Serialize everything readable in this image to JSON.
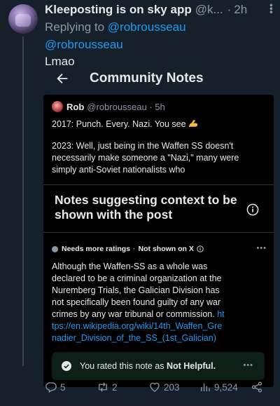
{
  "tweet": {
    "display_name": "Kleeposting is on sky app",
    "handle": "@k...",
    "separator": "·",
    "time": "2h",
    "replying_prefix": "Replying to",
    "replying_to": "@robrousseau",
    "mention": "@robrousseau",
    "text": "Lmao"
  },
  "community_notes": {
    "title": "Community Notes",
    "quoted_post": {
      "name": "Rob",
      "handle_time": "@robrousseau · 5h",
      "line1": "2017: Punch. Every. Nazi. You see",
      "line2": "2023: Well, just being in the Waffen SS doesn't necessarily make someone a \"Nazi,\" many were simply anti-Soviet nationalists who"
    },
    "heading": "Notes suggesting context to be shown with the post",
    "note": {
      "status": "Needs more ratings",
      "separator": "·",
      "visibility": "Not shown on X",
      "more": "•••",
      "text": "Although the Waffen-SS as a whole was declared to be a criminal organization at the Nuremberg Trials, the Galician Division has not specifically been found guilty of any war crimes by any war tribunal or commission.",
      "link": "https://en.wikipedia.org/wiki/14th_Waffen_Grenadier_Division_of_the_SS_(1st_Galician)"
    },
    "rating": {
      "prefix": "You rated this note as",
      "value": "Not Helpful.",
      "more": "•••"
    }
  },
  "actions": {
    "replies": "5",
    "reposts": "2",
    "likes": "203",
    "views": "9,524"
  },
  "colors": {
    "background": "#15202b",
    "accent": "#1d9bf0",
    "muted": "#8b98a5",
    "card": "#000000",
    "rated_box": "#0d1f17"
  }
}
